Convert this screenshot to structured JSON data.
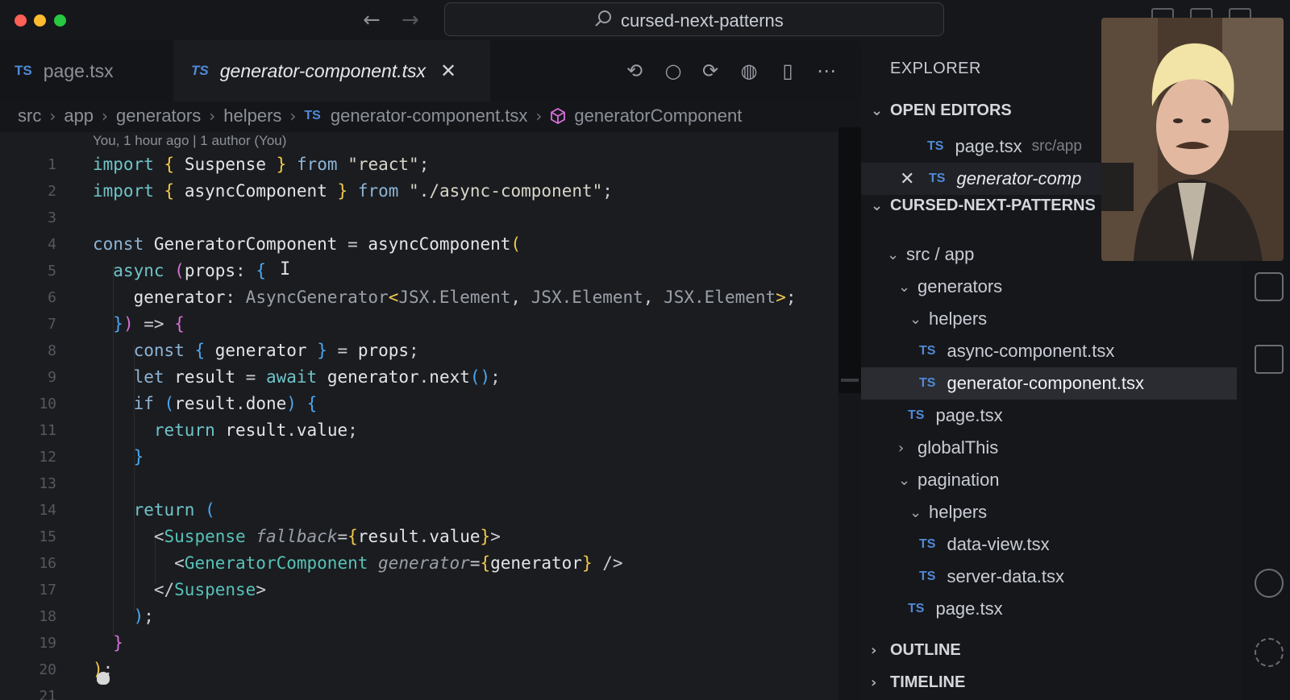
{
  "titlebar": {
    "search_text": "cursed-next-patterns",
    "back_icon": "arrow-left-icon",
    "forward_icon": "arrow-right-icon"
  },
  "tabs": [
    {
      "lang": "TS",
      "label": "page.tsx",
      "active": false
    },
    {
      "lang": "TS",
      "label": "generator-component.tsx",
      "active": true
    }
  ],
  "breadcrumb": {
    "parts": [
      "src",
      "app",
      "generators",
      "helpers"
    ],
    "file_lang": "TS",
    "file": "generator-component.tsx",
    "symbol": "generatorComponent"
  },
  "editor": {
    "blame": "You, 1 hour ago | 1 author (You)",
    "line_numbers": [
      "1",
      "2",
      "3",
      "4",
      "5",
      "6",
      "7",
      "8",
      "9",
      "10",
      "11",
      "12",
      "13",
      "14",
      "15",
      "16",
      "17",
      "18",
      "19",
      "20",
      "21"
    ]
  },
  "explorer": {
    "title": "EXPLORER",
    "open_editors_title": "OPEN EDITORS",
    "open_editors": [
      {
        "lang": "TS",
        "label": "page.tsx",
        "path": "src/app"
      },
      {
        "lang": "TS",
        "label": "generator-comp",
        "path": ""
      }
    ],
    "project_title": "CURSED-NEXT-PATTERNS",
    "tree": [
      {
        "label": "src / app",
        "kind": "folder-open"
      },
      {
        "label": "generators",
        "kind": "folder-open"
      },
      {
        "label": "helpers",
        "kind": "folder-open"
      },
      {
        "label": "async-component.tsx",
        "kind": "file",
        "lang": "TS"
      },
      {
        "label": "generator-component.tsx",
        "kind": "file",
        "lang": "TS"
      },
      {
        "label": "page.tsx",
        "kind": "file",
        "lang": "TS"
      },
      {
        "label": "globalThis",
        "kind": "folder-closed"
      },
      {
        "label": "pagination",
        "kind": "folder-open"
      },
      {
        "label": "helpers",
        "kind": "folder-open"
      },
      {
        "label": "data-view.tsx",
        "kind": "file",
        "lang": "TS"
      },
      {
        "label": "server-data.tsx",
        "kind": "file",
        "lang": "TS"
      },
      {
        "label": "page.tsx",
        "kind": "file",
        "lang": "TS"
      }
    ],
    "outline_title": "OUTLINE",
    "timeline_title": "TIMELINE"
  },
  "colors": {
    "editor_bg": "#1b1c20",
    "keyword": "#6ec4c8",
    "ts_badge": "#4f8ad8",
    "bracket_gold": "#f2c94c",
    "bracket_pink": "#d670d6",
    "bracket_blue": "#4aa8f0"
  }
}
